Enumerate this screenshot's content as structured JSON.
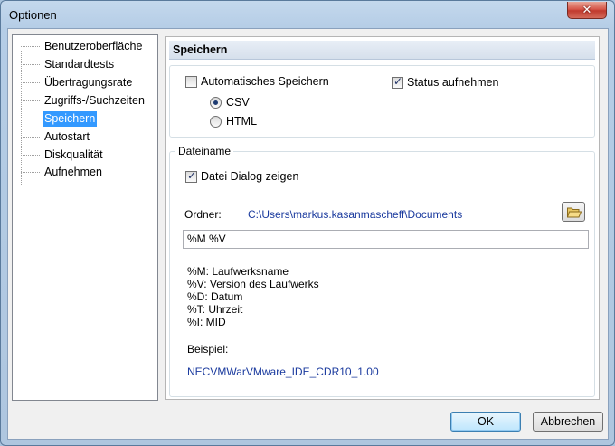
{
  "window": {
    "title": "Optionen",
    "close_glyph": "✕"
  },
  "tree": {
    "items": [
      {
        "label": "Benutzeroberfläche"
      },
      {
        "label": "Standardtests"
      },
      {
        "label": "Übertragungsrate"
      },
      {
        "label": "Zugriffs-/Suchzeiten"
      },
      {
        "label": "Speichern",
        "selected": true
      },
      {
        "label": "Autostart"
      },
      {
        "label": "Diskqualität"
      },
      {
        "label": "Aufnehmen"
      }
    ]
  },
  "panel": {
    "header": "Speichern",
    "auto_save": {
      "label": "Automatisches Speichern",
      "checked": false
    },
    "status_record": {
      "label": "Status aufnehmen",
      "checked": true
    },
    "format": {
      "options": [
        {
          "label": "CSV",
          "selected": true
        },
        {
          "label": "HTML",
          "selected": false
        }
      ]
    },
    "filename_group": {
      "legend": "Dateiname",
      "show_dialog": {
        "label": "Datei Dialog zeigen",
        "checked": true
      },
      "folder_label": "Ordner:",
      "folder_path": "C:\\Users\\markus.kasanmascheff\\Documents",
      "pattern_value": "%M %V",
      "legend_lines": [
        "%M: Laufwerksname",
        "%V: Version des Laufwerks",
        "%D: Datum",
        "%T: Uhrzeit",
        "%I: MID"
      ],
      "example_label": "Beispiel:",
      "example_value": "NECVMWarVMware_IDE_CDR10_1.00"
    }
  },
  "buttons": {
    "ok": "OK",
    "cancel": "Abbrechen"
  },
  "colors": {
    "selection": "#3399ff",
    "link_text": "#1a3a9e",
    "close": "#c03a2e"
  },
  "icons": {
    "folder_button": "folder-open-icon",
    "close": "close-icon"
  }
}
